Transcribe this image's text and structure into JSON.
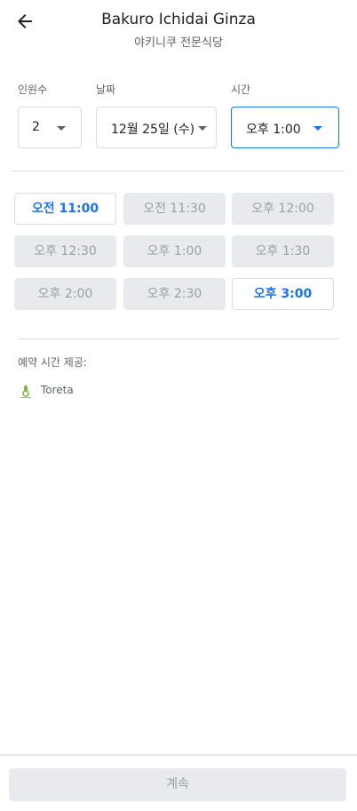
{
  "header": {
    "title": "Bakuro Ichidai Ginza",
    "subtitle": "야키니쿠 전문식당"
  },
  "fields": {
    "party_label": "인원수",
    "party_value": "2",
    "date_label": "날짜",
    "date_value": "12월 25일 (수)",
    "time_label": "시간",
    "time_value": "오후 1:00"
  },
  "time_slots": [
    {
      "label": "오전 11:00",
      "available": true
    },
    {
      "label": "오전 11:30",
      "available": false
    },
    {
      "label": "오후 12:00",
      "available": false
    },
    {
      "label": "오후 12:30",
      "available": false
    },
    {
      "label": "오후 1:00",
      "available": false
    },
    {
      "label": "오후 1:30",
      "available": false
    },
    {
      "label": "오후 2:00",
      "available": false
    },
    {
      "label": "오후 2:30",
      "available": false
    },
    {
      "label": "오후 3:00",
      "available": true
    }
  ],
  "provider": {
    "label": "예약 시간 제공:",
    "name": "Toreta"
  },
  "footer": {
    "continue_label": "계속"
  },
  "colors": {
    "accent": "#1a73e8",
    "disabled_bg": "#e8eaed",
    "disabled_text": "#9aa0a6",
    "provider_green": "#7cb342"
  }
}
